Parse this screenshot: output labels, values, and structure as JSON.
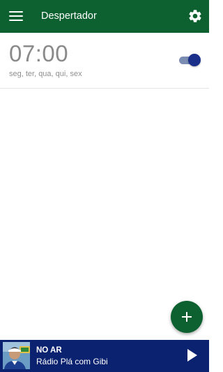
{
  "app_bar": {
    "title": "Despertador",
    "background_color": "#0d6130",
    "menu_icon": "menu-icon",
    "settings_icon": "gear-icon"
  },
  "alarms": [
    {
      "time": "07:00",
      "days": "seg, ter, qua, qui, sex",
      "enabled": true
    }
  ],
  "fab": {
    "icon": "plus-icon",
    "color": "#0d6130"
  },
  "player": {
    "status_label": "NO AR",
    "program": "Rádio Plá com Gibi",
    "background_color": "#0a2270",
    "action_icon": "play-icon"
  }
}
